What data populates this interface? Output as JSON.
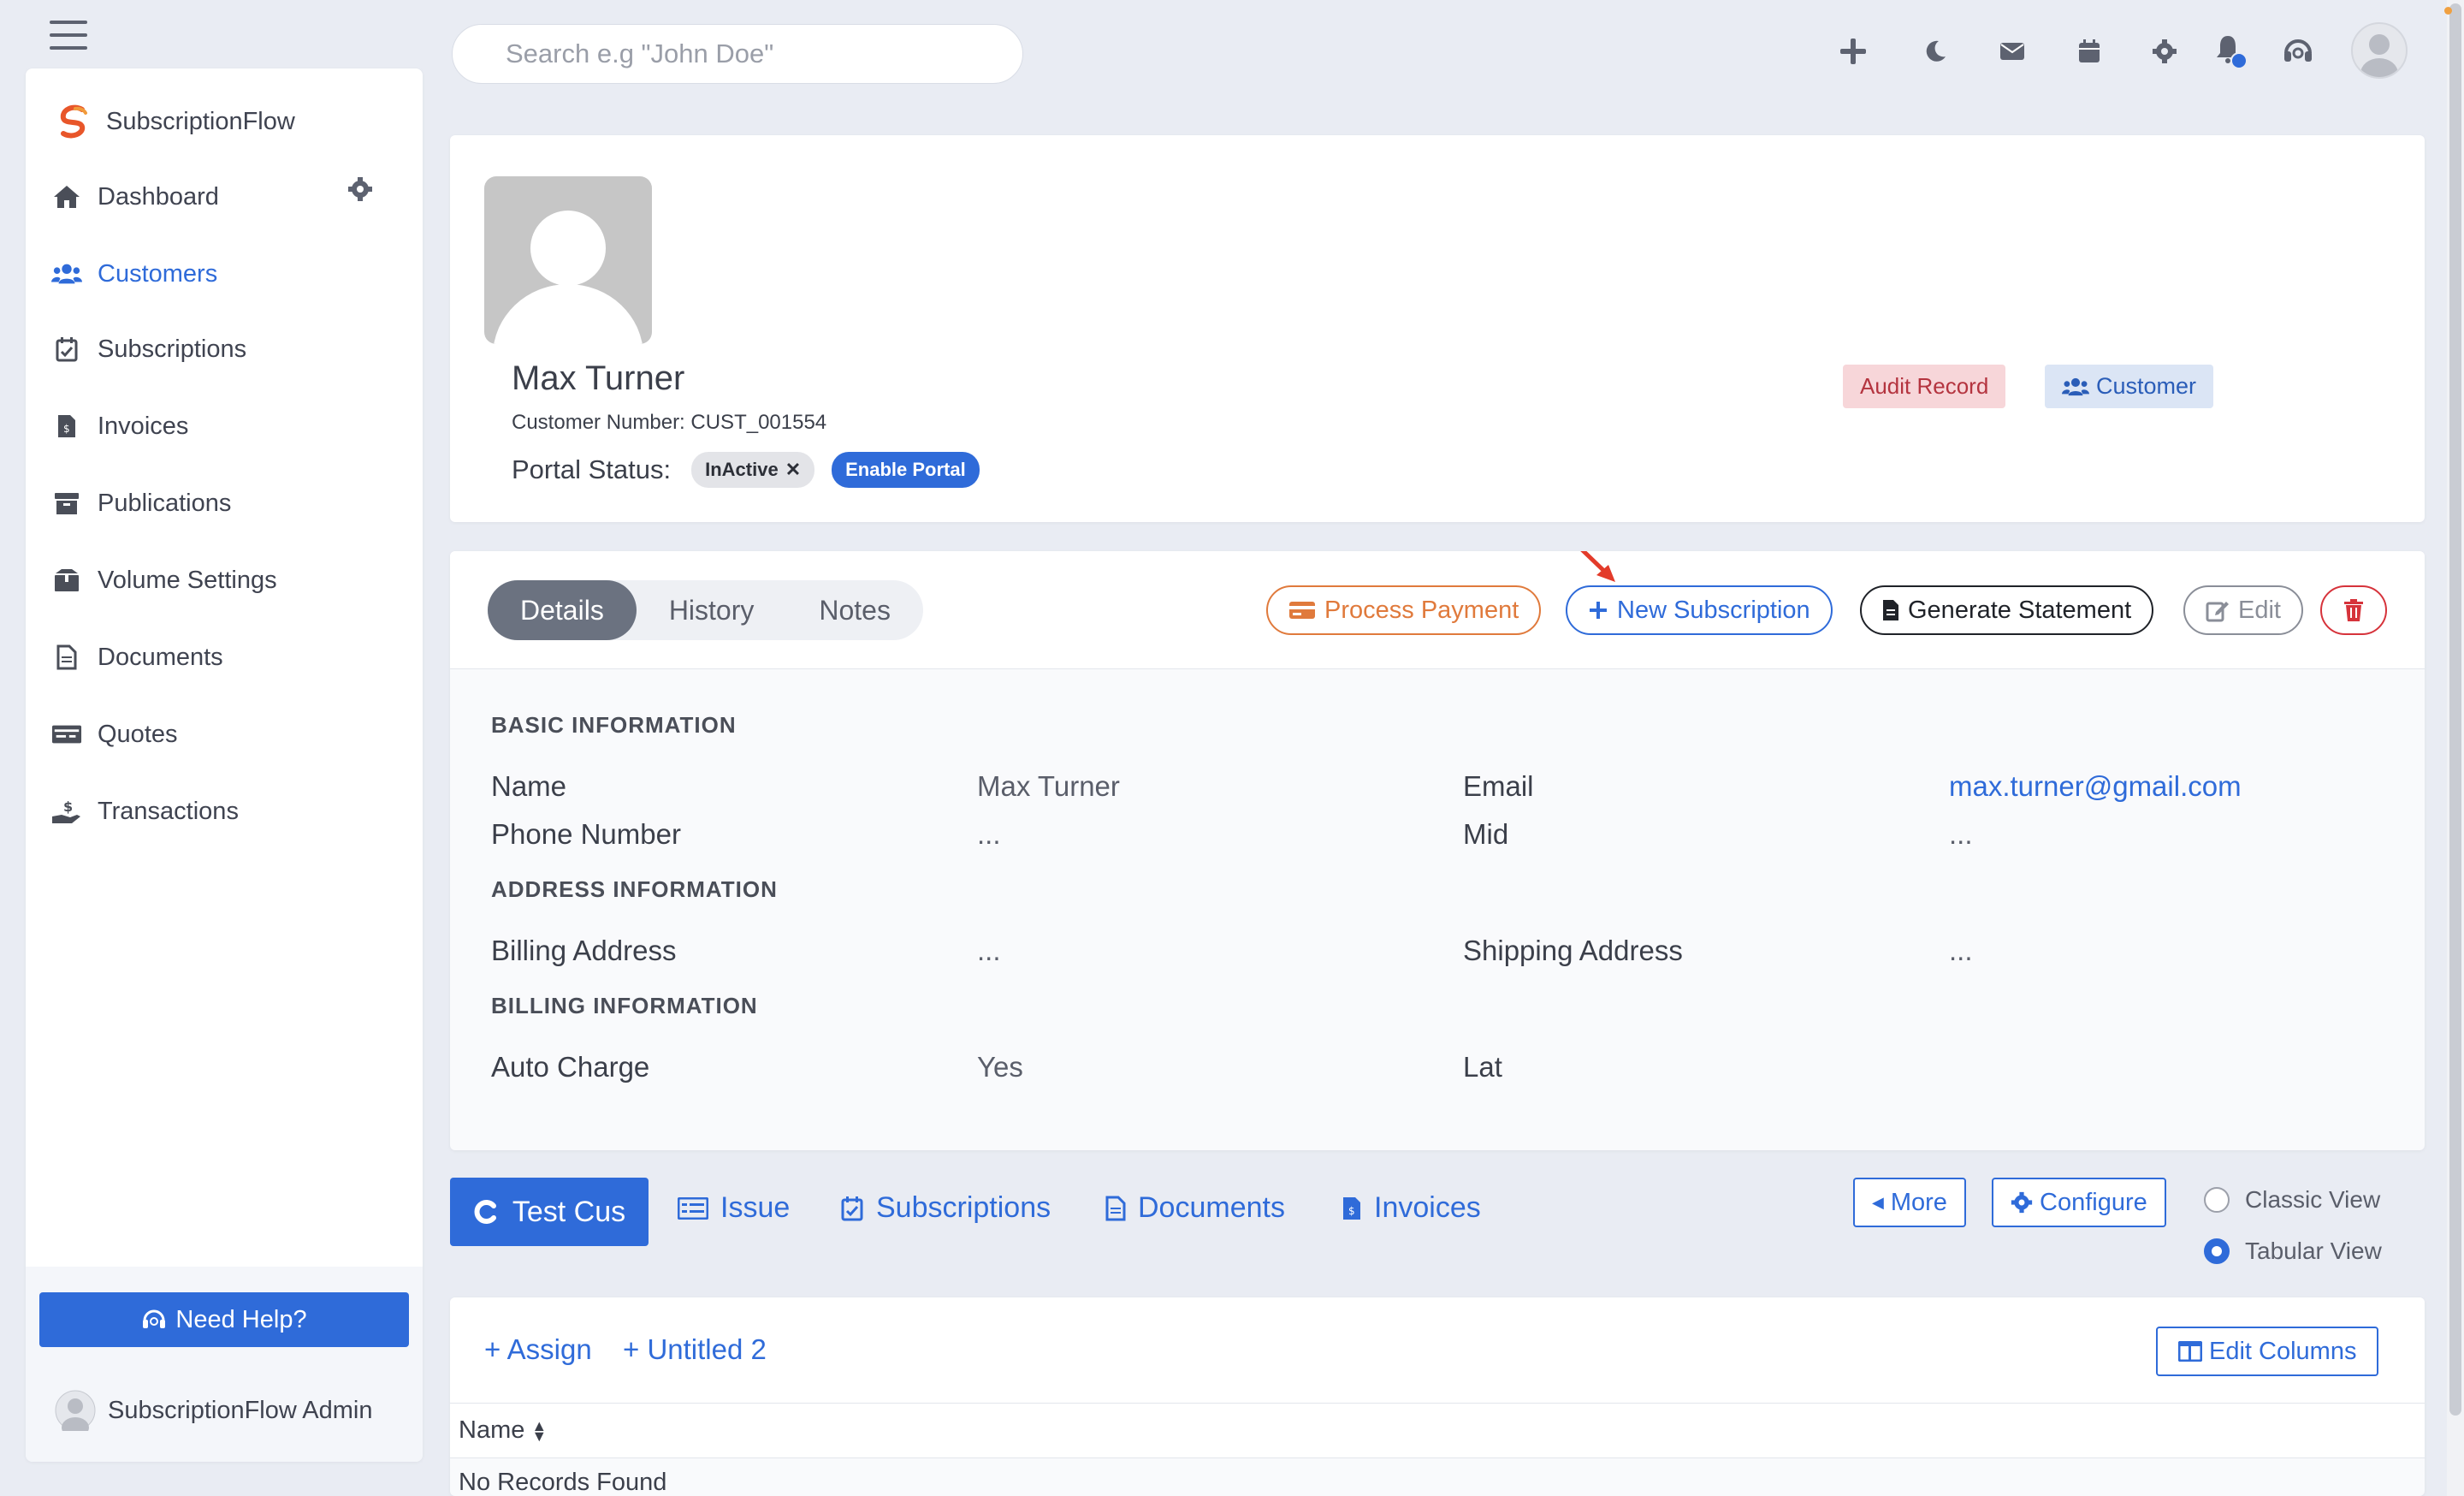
{
  "app": {
    "name": "SubscriptionFlow"
  },
  "search": {
    "placeholder": "Search e.g \"John Doe\""
  },
  "sidebar": {
    "items": [
      {
        "label": "Dashboard",
        "icon": "home-icon"
      },
      {
        "label": "Customers",
        "icon": "users-icon",
        "active": true
      },
      {
        "label": "Subscriptions",
        "icon": "calendar-check-icon"
      },
      {
        "label": "Invoices",
        "icon": "invoice-icon"
      },
      {
        "label": "Publications",
        "icon": "archive-icon"
      },
      {
        "label": "Volume Settings",
        "icon": "box-icon"
      },
      {
        "label": "Documents",
        "icon": "document-icon"
      },
      {
        "label": "Quotes",
        "icon": "money-bill-icon"
      },
      {
        "label": "Transactions",
        "icon": "hand-dollar-icon"
      }
    ],
    "help_label": "Need Help?",
    "admin_name": "SubscriptionFlow Admin"
  },
  "topbar": {
    "icons": [
      "plus-icon",
      "moon-icon",
      "envelope-icon",
      "calendar-icon",
      "gear-icon",
      "bell-icon",
      "headset-icon",
      "user-avatar"
    ]
  },
  "profile": {
    "name": "Max Turner",
    "customer_number": "Customer Number: CUST_001554",
    "portal_status_label": "Portal Status:",
    "portal_status": "InActive",
    "enable_portal_label": "Enable Portal",
    "audit_record_label": "Audit Record",
    "customer_badge_label": "Customer"
  },
  "details": {
    "tabs": [
      "Details",
      "History",
      "Notes"
    ],
    "active_tab": "Details",
    "actions": {
      "process_payment": "Process Payment",
      "new_subscription": "New Subscription",
      "generate_statement": "Generate Statement",
      "edit": "Edit"
    },
    "sections": {
      "basic": "BASIC INFORMATION",
      "address": "ADDRESS INFORMATION",
      "billing": "BILLING INFORMATION"
    },
    "fields": {
      "name_label": "Name",
      "name_value": "Max Turner",
      "email_label": "Email",
      "email_value": "max.turner@gmail.com",
      "phone_label": "Phone Number",
      "phone_value": "...",
      "mid_label": "Mid",
      "mid_value": "...",
      "billing_address_label": "Billing Address",
      "billing_address_value": "...",
      "shipping_address_label": "Shipping Address",
      "shipping_address_value": "...",
      "auto_charge_label": "Auto Charge",
      "auto_charge_value": "Yes",
      "lat_label": "Lat"
    }
  },
  "subtabs": {
    "active": "Test Cus",
    "items": [
      "Issue",
      "Subscriptions",
      "Documents",
      "Invoices"
    ],
    "more_label": "More",
    "configure_label": "Configure",
    "classic_view_label": "Classic View",
    "tabular_view_label": "Tabular View",
    "selected_view": "Tabular View"
  },
  "list": {
    "assign_label": "+ Assign",
    "untitled_label": "+ Untitled 2",
    "edit_columns_label": "Edit Columns",
    "column_name": "Name",
    "empty_text": "No Records Found"
  },
  "colors": {
    "primary": "#2f6bd9",
    "orange": "#e07a3c",
    "danger": "#d6333b",
    "audit_bg": "#f7d6d9"
  }
}
